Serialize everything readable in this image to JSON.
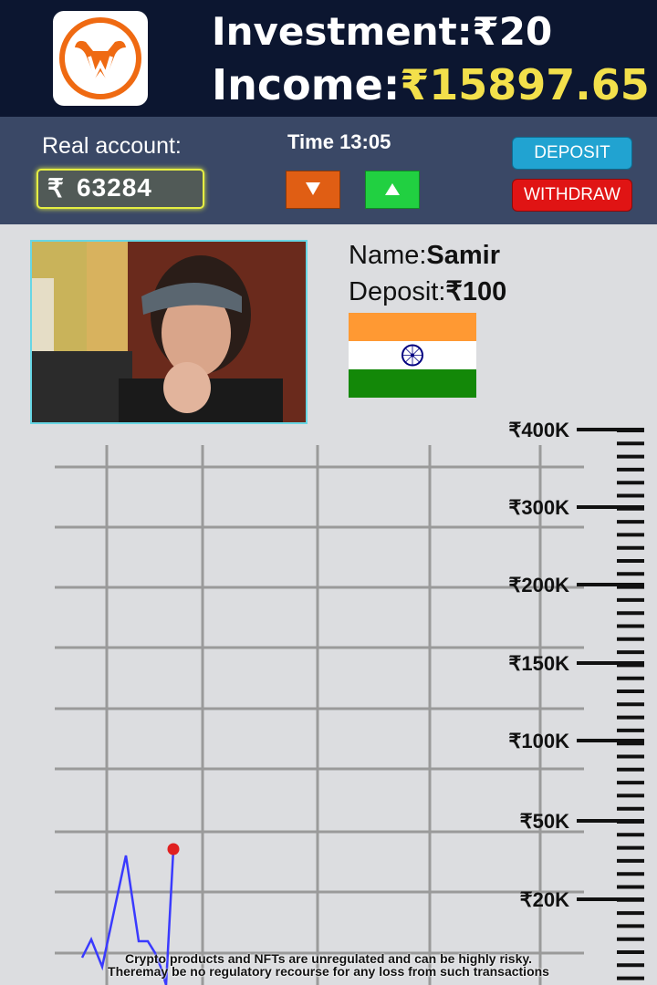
{
  "header": {
    "investment_label": "Investment:",
    "investment_value": "₹20",
    "income_label": "Income:",
    "income_value": "₹15897.65",
    "logo_icon": "bull-w-logo-icon"
  },
  "account": {
    "label": "Real account:",
    "currency": "₹",
    "balance": "63284",
    "time_label": "Time 13:05",
    "deposit_button": "DEPOSIT",
    "withdraw_button": "WITHDRAW",
    "down_icon": "triangle-down-icon",
    "up_icon": "triangle-up-icon"
  },
  "profile": {
    "name_label": "Name:",
    "name_value": "Samir",
    "deposit_label": "Deposit:",
    "deposit_value": "₹100",
    "flag": "india-flag"
  },
  "colors": {
    "header_bg": "#0c1630",
    "income_yellow": "#f3e04b",
    "bar_bg": "#3a4866",
    "down_orange": "#e05e14",
    "up_green": "#21d041",
    "deposit_blue": "#21a3d1",
    "withdraw_red": "#e01414",
    "line_blue": "#3a3aff",
    "marker_red": "#e02020"
  },
  "chart_data": {
    "type": "line",
    "axis_labels": [
      "₹400K",
      "₹300K",
      "₹200K",
      "₹150K",
      "₹100K",
      "₹50K",
      "₹20K"
    ],
    "grid": true
  },
  "disclaimer": {
    "line1": "Crypto products and NFTs are unregulated and can be highly risky.",
    "line2": "Theremay be no regulatory recourse for any loss from such transactions"
  }
}
